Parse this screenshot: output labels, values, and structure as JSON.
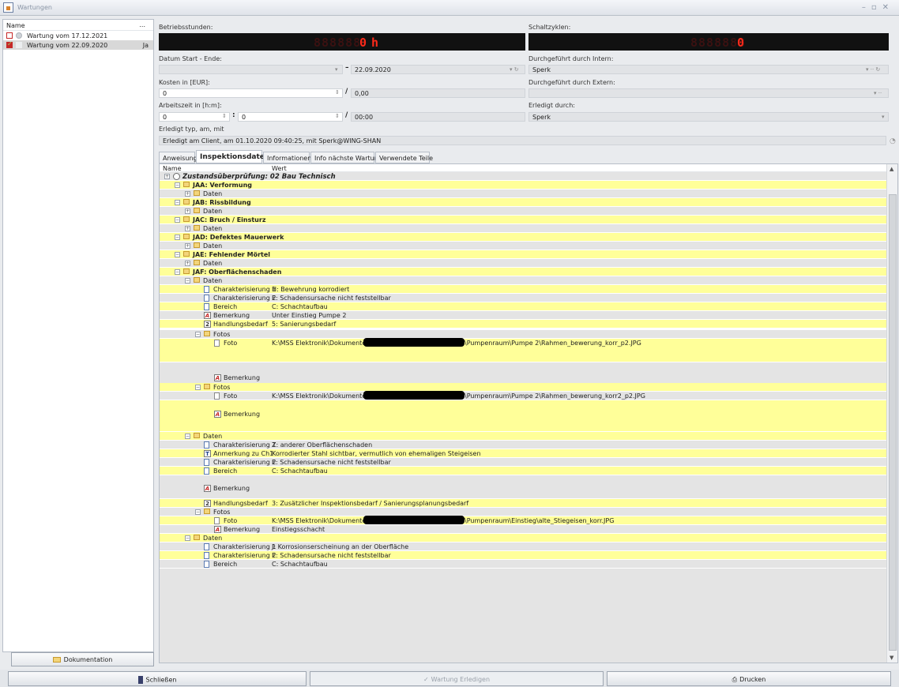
{
  "window": {
    "title": "Wartungen"
  },
  "sidebar": {
    "header": "Name",
    "dots": "...",
    "items": [
      {
        "label": "Wartung vom 17.12.2021",
        "checked": false,
        "flag": ""
      },
      {
        "label": "Wartung vom 22.09.2020",
        "checked": true,
        "flag": "Ja"
      }
    ],
    "button": "Dokumentation"
  },
  "form": {
    "betriebsstunden_label": "Betriebsstunden:",
    "betriebsstunden_ghost": "888888",
    "betriebsstunden_value": "0",
    "betriebsstunden_unit": "h",
    "schaltzyklen_label": "Schaltzyklen:",
    "schaltzyklen_ghost": "8888888",
    "schaltzyklen_value": "0",
    "datum_label": "Datum Start - Ende:",
    "datum_start": "",
    "datum_sep": "–",
    "datum_end": "22.09.2020",
    "intern_label": "Durchgeführt durch Intern:",
    "intern_value": "Sperk",
    "kosten_label": "Kosten in [EUR]:",
    "kosten_value": "0",
    "kosten_sep": "/",
    "kosten_value2": "0,00",
    "extern_label": "Durchgeführt durch Extern:",
    "extern_value": "",
    "arbeitszeit_label": "Arbeitszeit in [h:m]:",
    "arbeitszeit_h": "0",
    "arbeitszeit_colon": ":",
    "arbeitszeit_m": "0",
    "arbeitszeit_sep": "/",
    "arbeitszeit_total": "00:00",
    "erledigt_label": "Erledigt durch:",
    "erledigt_value": "Sperk",
    "erledigt_typ_label": "Erledigt typ, am, mit",
    "erledigt_typ_value": "Erledigt am Client, am 01.10.2020 09:40:25, mit Sperk@WING-SHAN"
  },
  "tabs": [
    "Anweisung",
    "Inspektionsdaten",
    "Informationen",
    "Info nächste Wartung",
    "Verwendete Teile"
  ],
  "grid": {
    "col_name": "Name",
    "col_wert": "Wert",
    "rows": [
      {
        "name": "Zustandsüberprüfung: 02 Bau Technisch",
        "value": "",
        "style": "ital",
        "icon": "circ"
      },
      {
        "name": "JAA: Verformung",
        "value": "",
        "style": "bold",
        "icon": "folder"
      },
      {
        "name": "Daten",
        "value": "",
        "style": "",
        "icon": "folder"
      },
      {
        "name": "JAB: Rissbildung",
        "value": "",
        "style": "bold",
        "icon": "folder"
      },
      {
        "name": "Daten",
        "value": "",
        "style": "",
        "icon": "folder"
      },
      {
        "name": "JAC: Bruch / Einsturz",
        "value": "",
        "style": "bold",
        "icon": "folder"
      },
      {
        "name": "Daten",
        "value": "",
        "style": "",
        "icon": "folder"
      },
      {
        "name": "JAD: Defektes Mauerwerk",
        "value": "",
        "style": "bold",
        "icon": "folder"
      },
      {
        "name": "Daten",
        "value": "",
        "style": "",
        "icon": "folder"
      },
      {
        "name": "JAE: Fehlender Mörtel",
        "value": "",
        "style": "bold",
        "icon": "folder"
      },
      {
        "name": "Daten",
        "value": "",
        "style": "",
        "icon": "folder"
      },
      {
        "name": "JAF: Oberflächenschaden",
        "value": "",
        "style": "bold",
        "icon": "folder"
      },
      {
        "name": "Daten",
        "value": "",
        "style": "",
        "icon": "folder"
      },
      {
        "name": "Charakterisierung 1",
        "value": "H: Bewehrung korrodiert",
        "style": "",
        "icon": "doc"
      },
      {
        "name": "Charakterisierung 2",
        "value": "E: Schadensursache nicht feststellbar",
        "style": "",
        "icon": "doc"
      },
      {
        "name": "Bereich",
        "value": "C: Schachtaufbau",
        "style": "",
        "icon": "doc"
      },
      {
        "name": "Bemerkung",
        "value": "Unter Einstieg Pumpe 2",
        "style": "",
        "icon": "a"
      },
      {
        "name": "Handlungsbedarf",
        "value": "5: Sanierungsbedarf",
        "style": "",
        "icon": "two"
      },
      {
        "name": "Fotos",
        "value": "",
        "style": "",
        "icon": "folder"
      },
      {
        "name": "Foto",
        "value": "K:\\MSS Elektronik\\Dokumente",
        "value2": "\\Pumpenraum\\Pumpe 2\\Rahmen_bewerung_korr_p2.JPG",
        "style": "",
        "icon": "photo"
      },
      {
        "name": "Bemerkung",
        "value": "",
        "style": "",
        "icon": "a"
      },
      {
        "name": "Fotos",
        "value": "",
        "style": "",
        "icon": "folder"
      },
      {
        "name": "Foto",
        "value": "K:\\MSS Elektronik\\Dokumente",
        "value2": "\\Pumpenraum\\Pumpe 2\\Rahmen_bewerung_korr2_p2.JPG",
        "style": "",
        "icon": "photo"
      },
      {
        "name": "Bemerkung",
        "value": "",
        "style": "",
        "icon": "a"
      },
      {
        "name": "Daten",
        "value": "",
        "style": "",
        "icon": "folder"
      },
      {
        "name": "Charakterisierung 1",
        "value": "Z: anderer Oberflächenschaden",
        "style": "",
        "icon": "doc"
      },
      {
        "name": "Anmerkung zu Ch1",
        "value": "Korrodierter Stahl sichtbar, vermutlich von ehemaligen Steigeisen",
        "style": "",
        "icon": "t"
      },
      {
        "name": "Charakterisierung 2",
        "value": "E: Schadensursache nicht feststellbar",
        "style": "",
        "icon": "doc"
      },
      {
        "name": "Bereich",
        "value": "C: Schachtaufbau",
        "style": "",
        "icon": "doc"
      },
      {
        "name": "Bemerkung",
        "value": "",
        "style": "",
        "icon": "a"
      },
      {
        "name": "Handlungsbedarf",
        "value": "3: Zusätzlicher Inspektionsbedarf / Sanierungsplanungsbedarf",
        "style": "",
        "icon": "two"
      },
      {
        "name": "Fotos",
        "value": "",
        "style": "",
        "icon": "folder"
      },
      {
        "name": "Foto",
        "value": "K:\\MSS Elektronik\\Dokumente",
        "value2": "\\Pumpenraum\\Einstieg\\alte_Stiegeisen_korr.JPG",
        "style": "",
        "icon": "photo"
      },
      {
        "name": "Bemerkung",
        "value": "Einstiegsschacht",
        "style": "",
        "icon": "a"
      },
      {
        "name": "Daten",
        "value": "",
        "style": "",
        "icon": "folder"
      },
      {
        "name": "Charakterisierung 1",
        "value": "J: Korrosionserscheinung an der Oberfläche",
        "style": "",
        "icon": "doc"
      },
      {
        "name": "Charakterisierung 2",
        "value": "E: Schadensursache nicht feststellbar",
        "style": "",
        "icon": "doc"
      },
      {
        "name": "Bereich",
        "value": "C: Schachtaufbau",
        "style": "",
        "icon": "doc"
      }
    ]
  },
  "bottom": {
    "close": "Schließen",
    "complete": "Wartung Erledigen",
    "print": "Drucken"
  },
  "colors": {
    "row_yellow": "#ffff99",
    "row_gray": "#e4e4e4",
    "led_red": "#ff2a1a"
  }
}
